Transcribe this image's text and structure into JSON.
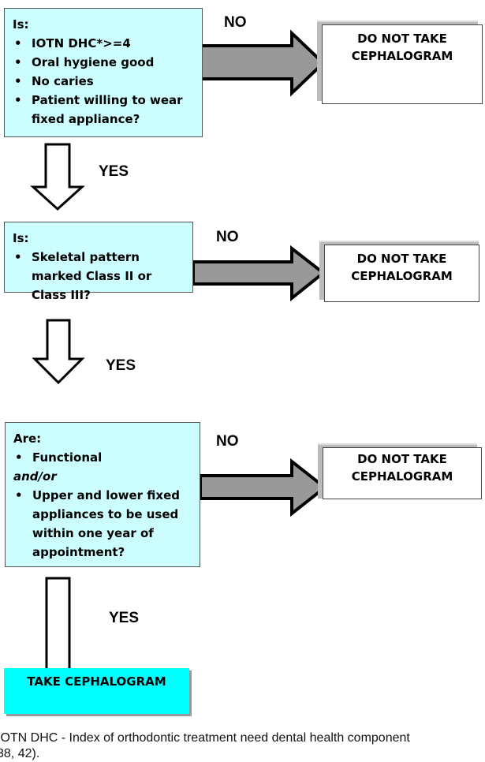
{
  "steps": [
    {
      "heading": "Is:",
      "items": [
        "IOTN DHC*>=4",
        "Oral hygiene good",
        "No caries",
        "Patient willing to wear fixed appliance?"
      ],
      "no_label": "NO",
      "yes_label": "YES",
      "outcome": "DO NOT TAKE CEPHALOGRAM"
    },
    {
      "heading": "Is:",
      "items": [
        "Skeletal pattern marked Class II or Class III?"
      ],
      "no_label": "NO",
      "yes_label": "YES",
      "outcome": "DO NOT TAKE CEPHALOGRAM"
    },
    {
      "heading": "Are:",
      "items": [
        "Functional",
        "Upper and lower fixed appliances to be used within one year of appointment?"
      ],
      "connector": "and/or",
      "no_label": "NO",
      "yes_label": "YES",
      "outcome": "DO NOT TAKE CEPHALOGRAM"
    }
  ],
  "final": "TAKE CEPHALOGRAM",
  "footnote": {
    "line1": "IOTN DHC - Index of orthodontic treatment need dental health component",
    "line2": "38, 42)."
  },
  "colors": {
    "question_box": "#ccfeff",
    "final_box": "#00ffff",
    "no_arrow": "#999999"
  }
}
